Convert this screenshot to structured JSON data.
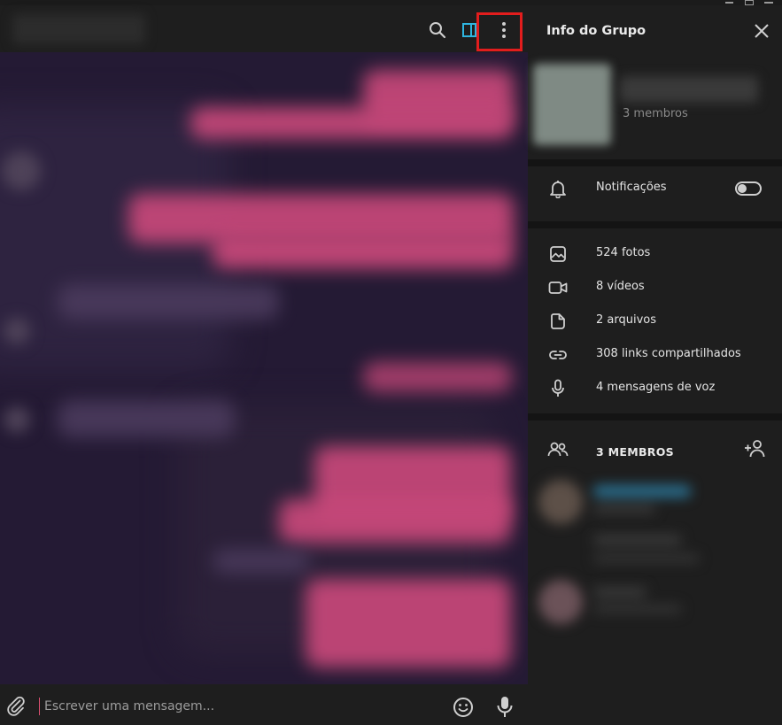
{
  "window_controls": [
    "minimize",
    "maximize",
    "close"
  ],
  "chat_header": {
    "icons": [
      "search-icon",
      "side-panel-icon",
      "more-vertical-icon"
    ],
    "accent_color": "#2fb6e0",
    "highlight_color": "#e21d1d"
  },
  "composer": {
    "placeholder": "Escrever uma mensagem...",
    "icons": [
      "paperclip-icon",
      "emoji-icon",
      "microphone-icon"
    ]
  },
  "info_panel": {
    "title": "Info do Grupo",
    "group_members_count": "3 membros",
    "notifications_label": "Notificações",
    "notifications_enabled": false,
    "media": [
      {
        "icon": "photo-icon",
        "label": "524 fotos"
      },
      {
        "icon": "video-icon",
        "label": "8 vídeos"
      },
      {
        "icon": "file-icon",
        "label": "2 arquivos"
      },
      {
        "icon": "link-icon",
        "label": "308 links compartilhados"
      },
      {
        "icon": "microphone-icon",
        "label": "4 mensagens de voz"
      }
    ],
    "members_header": "3 MEMBROS"
  },
  "colors": {
    "panel_bg": "#1e1e1e",
    "chat_bg": "#241a34",
    "bubble": "#c8487a",
    "text": "#e4e4e4",
    "muted": "#8a8a8a"
  }
}
